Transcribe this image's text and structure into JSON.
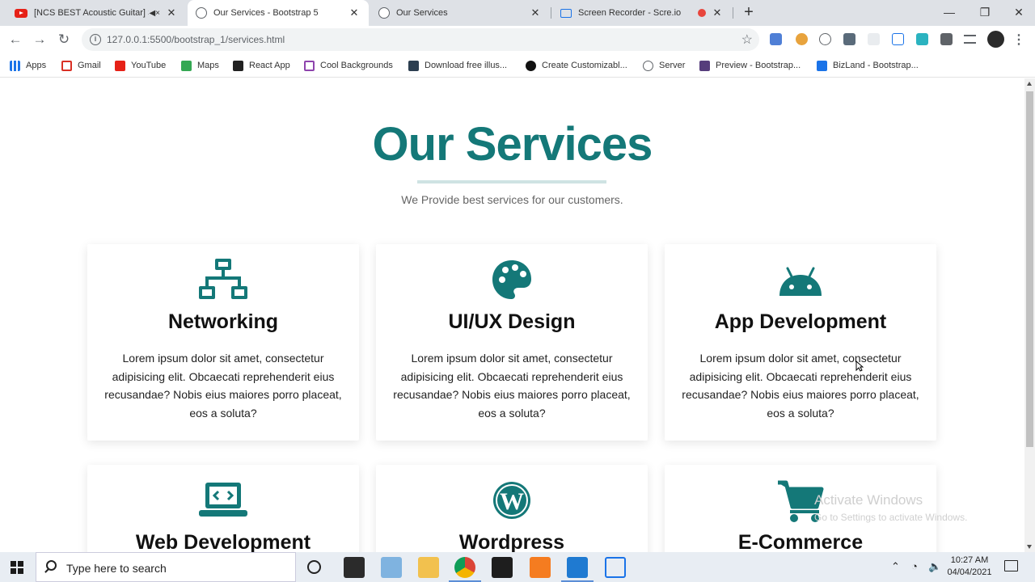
{
  "browser": {
    "tabs": [
      {
        "title": "[NCS BEST Acoustic Guitar] S",
        "icon": "youtube-icon",
        "active": false
      },
      {
        "title": "Our Services - Bootstrap 5",
        "icon": "globe-icon",
        "active": true
      },
      {
        "title": "Our Services",
        "icon": "globe-icon",
        "active": false
      },
      {
        "title": "Screen Recorder - Scre.io",
        "icon": "screen-recorder-icon",
        "active": false
      }
    ],
    "url": "127.0.0.1:5500/bootstrap_1/services.html",
    "bookmarks": [
      {
        "label": "Apps",
        "icon": "apps-grid-icon",
        "color": "#1a73e8"
      },
      {
        "label": "Gmail",
        "icon": "gmail-icon",
        "color": "#d93025"
      },
      {
        "label": "YouTube",
        "icon": "youtube-icon",
        "color": "#e62117"
      },
      {
        "label": "Maps",
        "icon": "maps-icon",
        "color": "#34a853"
      },
      {
        "label": "React App",
        "icon": "react-icon",
        "color": "#222222"
      },
      {
        "label": "Cool Backgrounds",
        "icon": "cool-backgrounds-icon",
        "color": "#8e44ad"
      },
      {
        "label": "Download free illus...",
        "icon": "storyset-icon",
        "color": "#2c3e50"
      },
      {
        "label": "Create Customizabl...",
        "icon": "create-icon",
        "color": "#111111"
      },
      {
        "label": "Server",
        "icon": "globe-icon",
        "color": "#5f6368"
      },
      {
        "label": "Preview - Bootstrap...",
        "icon": "bootstrap-icon",
        "color": "#563d7c"
      },
      {
        "label": "BizLand - Bootstrap...",
        "icon": "bizland-icon",
        "color": "#1a73e8"
      }
    ]
  },
  "page": {
    "heading": "Our Services",
    "subtitle": "We Provide best services for our customers.",
    "accent_color": "#147878",
    "services": [
      {
        "title": "Networking",
        "icon": "network-icon",
        "description": "Lorem ipsum dolor sit amet, consectetur adipisicing elit. Obcaecati reprehenderit eius recusandae? Nobis eius maiores porro placeat, eos a soluta?"
      },
      {
        "title": "UI/UX Design",
        "icon": "palette-icon",
        "description": "Lorem ipsum dolor sit amet, consectetur adipisicing elit. Obcaecati reprehenderit eius recusandae? Nobis eius maiores porro placeat, eos a soluta?"
      },
      {
        "title": "App Development",
        "icon": "android-icon",
        "description": "Lorem ipsum dolor sit amet, consectetur adipisicing elit. Obcaecati reprehenderit eius recusandae? Nobis eius maiores porro placeat, eos a soluta?"
      },
      {
        "title": "Web Development",
        "icon": "laptop-code-icon",
        "description": ""
      },
      {
        "title": "Wordpress",
        "icon": "wordpress-icon",
        "description": ""
      },
      {
        "title": "E-Commerce",
        "icon": "cart-icon",
        "description": ""
      }
    ]
  },
  "watermark": {
    "line1": "Activate Windows",
    "line2": "Go to Settings to activate Windows."
  },
  "taskbar": {
    "search_placeholder": "Type here to search",
    "time": "10:27 AM",
    "date": "04/04/2021"
  }
}
